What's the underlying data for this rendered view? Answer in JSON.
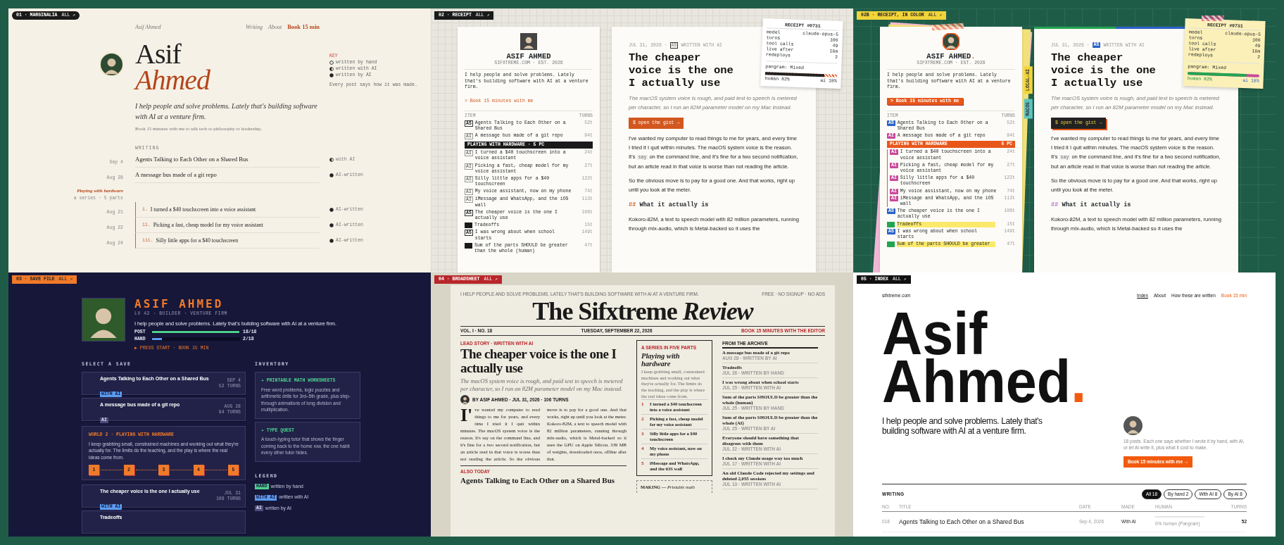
{
  "panels": [
    {
      "kind": "marginalia",
      "tag": {
        "label": "01 · MARGINALIA",
        "link": "ALL ↗"
      },
      "nav": {
        "brand": "Asif Ahmed",
        "links": [
          {
            "label": "Writing"
          },
          {
            "label": "About"
          },
          {
            "label": "Book 15 min",
            "kind": "cta"
          }
        ]
      },
      "name_first": "Asif",
      "name_last": "Ahmed",
      "key": {
        "title": "KEY",
        "items": [
          {
            "kind": "hand",
            "label": "written by hand"
          },
          {
            "kind": "with",
            "label": "written with AI"
          },
          {
            "kind": "by",
            "label": "written by AI"
          }
        ],
        "note": "Every post says how it was made."
      },
      "tagline": "I help people and solve problems. Lately that's building software with AI at a venture firm.",
      "book": {
        "link": "Book 15 minutes with me",
        "rest": " to talk tech or philosophy or leadership."
      },
      "writing_label": "WRITING",
      "posts": [
        {
          "date": "Sep 4",
          "title": "Agents Talking to Each Other on a Shared Bus",
          "made": {
            "kind": "with",
            "label": "with AI"
          }
        },
        {
          "date": "Aug 28",
          "title": "A message bus made of a git repo",
          "made": {
            "kind": "by",
            "label": "AI-written"
          }
        }
      ],
      "series": {
        "title": "Playing with hardware",
        "meta": "a series · 5 parts",
        "posts": [
          {
            "num": "i.",
            "date": "Aug 21",
            "title": "I turned a $40 touchscreen into a voice assistant",
            "made": {
              "kind": "by",
              "label": "AI-written"
            }
          },
          {
            "num": "ii.",
            "date": "Aug 22",
            "title": "Picking a fast, cheap model for my voice assistant",
            "made": {
              "kind": "by",
              "label": "AI-written"
            }
          },
          {
            "num": "iii.",
            "date": "Aug 24",
            "title": "Silly little apps for a $40 touchscreen",
            "made": {
              "kind": "by",
              "label": "AI-written"
            }
          }
        ]
      }
    },
    {
      "kind": "receipt",
      "tag": {
        "label": "02 · RECEIPT",
        "link": "ALL ↗"
      },
      "card": {
        "name": "ASIF AHMED",
        "sub": "SIFXTREME.COM · EST. 2026",
        "intro": "I help people and solve problems. Lately that's building software with AI at a venture firm.",
        "book": "> Book 15 minutes with me",
        "columns": [
          "ITEM",
          "TURNS"
        ],
        "items": [
          {
            "kind": "post",
            "badge": {
              "kind": "assisted",
              "text": "AS"
            },
            "title": "Agents Talking to Each Other on a Shared Bus",
            "turns": "52t"
          },
          {
            "kind": "post",
            "badge": {
              "kind": "ai",
              "text": "AI"
            },
            "title": "A message bus made of a git repo",
            "turns": "94t"
          },
          {
            "kind": "series",
            "title": "PLAYING WITH HARDWARE · 5 PC",
            "children": [
              {
                "kind": "post",
                "badge": {
                  "kind": "ai",
                  "text": "AI"
                },
                "title": "I turned a $40 touchscreen into a voice assistant",
                "turns": "24t"
              },
              {
                "kind": "post",
                "badge": {
                  "kind": "ai",
                  "text": "AI"
                },
                "title": "Picking a fast, cheap model for my voice assistant",
                "turns": "27t"
              },
              {
                "kind": "post",
                "badge": {
                  "kind": "ai",
                  "text": "AI"
                },
                "title": "Silly little apps for a $40 touchscreen",
                "turns": "122t"
              },
              {
                "kind": "post",
                "badge": {
                  "kind": "ai",
                  "text": "AI"
                },
                "title": "My voice assistant, now on my phone",
                "turns": "74t"
              },
              {
                "kind": "post",
                "badge": {
                  "kind": "ai",
                  "text": "AI"
                },
                "title": "iMessage and WhatsApp, and the iOS wall",
                "turns": "113t"
              }
            ]
          },
          {
            "kind": "post",
            "badge": {
              "kind": "assisted",
              "text": "AS"
            },
            "title": "The cheaper voice is the one I actually use",
            "turns": "106t"
          },
          {
            "kind": "post",
            "badge": {
              "kind": "hand"
            },
            "title": "Tradeoffs",
            "turns": "15t"
          },
          {
            "kind": "post",
            "badge": {
              "kind": "assisted",
              "text": "AS"
            },
            "title": "I was wrong about when school starts",
            "turns": "149t"
          },
          {
            "kind": "post",
            "badge": {
              "kind": "hand"
            },
            "title": "Sum of the parts SHOULD be greater than the whole (human)",
            "turns": "47t"
          }
        ]
      },
      "article": {
        "date": "JUL 31, 2026 ·",
        "badge": {
          "kind": "assisted",
          "text": "AS"
        },
        "made": "WRITTEN WITH AI",
        "title": "The cheaper voice is the one I actually use",
        "dek": "The macOS system voice is rough, and paid text to speech is metered per character, so I run an 82M parameter model on my Mac instead.",
        "button": "$ open the gist →",
        "paragraphs": [
          {
            "before": "I've wanted my computer to read things to me for years, and every time I tried it I quit within minutes. The macOS system voice is the reason. It's ",
            "code": "say",
            "after": " on the command line, and it's fine for a two second notification, but an article read in that voice is worse than not reading the article."
          },
          {
            "before": "So the obvious move is to pay for a good one. And that works, right up until you look at the meter."
          }
        ],
        "heading": {
          "mark": "##",
          "text": "What it actually is"
        },
        "last": "Kokoro-82M, a text to speech model with 82 million parameters, running through mlx-audio, which is Metal-backed so it uses the"
      },
      "receipt": {
        "title": "RECEIPT #0731",
        "rows": [
          {
            "label": "model",
            "value": "claude-opus-5"
          },
          {
            "label": "turns",
            "value": "106"
          },
          {
            "label": "tool calls",
            "value": "49"
          },
          {
            "label": "live after",
            "value": "16m"
          },
          {
            "label": "redeploys",
            "value": "2"
          }
        ],
        "pangram": "pangram: Mixed",
        "level": 0.82,
        "human": "human 82%",
        "ai": "ai 18%"
      }
    },
    {
      "kind": "receipt_color",
      "tag": {
        "label": "02B · RECEIPT, IN COLOR",
        "link": "ALL ↗"
      },
      "card": {
        "name": "ASIF AHMED",
        "period": ".",
        "sub": "SIFXTREME.COM · EST. 2026",
        "intro": "I help people and solve problems. Lately that's building software with AI at a venture firm.",
        "book": "> Book 15 minutes with me",
        "columns": [
          "ITEM",
          "TURNS"
        ],
        "items": [
          {
            "kind": "post",
            "badge": {
              "kind": "assisted",
              "text": "AS"
            },
            "title": "Agents Talking to Each Other on a Shared Bus",
            "turns": "52t"
          },
          {
            "kind": "post",
            "badge": {
              "kind": "ai",
              "text": "AI"
            },
            "title": "A message bus made of a git repo",
            "turns": "94t"
          },
          {
            "kind": "series",
            "title": "PLAYING WITH HARDWARE",
            "count": "5 PC",
            "children": [
              {
                "kind": "post",
                "badge": {
                  "kind": "ai",
                  "text": "AI"
                },
                "title": "I turned a $40 touchscreen into a voice assistant",
                "turns": "24t"
              },
              {
                "kind": "post",
                "badge": {
                  "kind": "ai",
                  "text": "AI"
                },
                "title": "Picking a fast, cheap model for my voice assistant",
                "turns": "27t"
              },
              {
                "kind": "post",
                "badge": {
                  "kind": "ai",
                  "text": "AI"
                },
                "title": "Silly little apps for a $40 touchscreen",
                "turns": "122t"
              },
              {
                "kind": "post",
                "badge": {
                  "kind": "ai",
                  "text": "AI"
                },
                "title": "My voice assistant, now on my phone",
                "turns": "74t"
              },
              {
                "kind": "post",
                "badge": {
                  "kind": "ai",
                  "text": "AI"
                },
                "title": "iMessage and WhatsApp, and the iOS wall",
                "turns": "113t"
              }
            ]
          },
          {
            "kind": "post",
            "badge": {
              "kind": "assisted",
              "text": "AS"
            },
            "title": "The cheaper voice is the one I actually use",
            "turns": "106t"
          },
          {
            "kind": "post",
            "badge": {
              "kind": "hand"
            },
            "title": "Tradeoffs",
            "turns": "15t"
          },
          {
            "kind": "post",
            "badge": {
              "kind": "assisted",
              "text": "AS"
            },
            "title": "I was wrong about when school starts",
            "turns": "149t"
          },
          {
            "kind": "post",
            "badge": {
              "kind": "hand"
            },
            "title": "Sum of the parts SHOULD be greater",
            "turns": "47t"
          }
        ]
      },
      "side_tabs": [
        {
          "label": "LOCAL-AI",
          "color": "#f2d43a"
        },
        {
          "label": "MACOS",
          "color": "#5cc3c0"
        }
      ],
      "article": {
        "date": "JUL 31, 2026 ·",
        "badge": {
          "kind": "assisted",
          "text": "AS"
        },
        "made": "WRITTEN WITH AI",
        "title": "The cheaper voice is the one I actually use",
        "dek": "The macOS system voice is rough, and paid text to speech is metered per character, so I run an 82M parameter model on my Mac instead.",
        "button": "$ open the gist →",
        "paragraphs": [
          {
            "before": "I've wanted my computer to read things to me for years, and every time I tried it I quit within minutes. The macOS system voice is the reason. It's ",
            "code": "say",
            "after": " on the command line, and it's fine for a two second notification, but an article read in that voice is worse than not reading the article."
          },
          {
            "before": "So the obvious move is to pay for a good one. And that works, right up until you look at the meter."
          }
        ],
        "heading": {
          "mark": "##",
          "text": "What it actually is"
        },
        "last": "Kokoro-82M, a text to speech model with 82 million parameters, running through mlx-audio, which is Metal-backed so it uses the"
      },
      "receipt": {
        "title": "RECEIPT #0731",
        "rows": [
          {
            "label": "model",
            "value": "claude-opus-5"
          },
          {
            "label": "turns",
            "value": "106"
          },
          {
            "label": "tool calls",
            "value": "49"
          },
          {
            "label": "live after",
            "value": "16m"
          },
          {
            "label": "redeploys",
            "value": "2"
          }
        ],
        "pangram": "pangram: Mixed",
        "level": 0.82,
        "human": "human 82%",
        "ai": "ai 18%"
      }
    },
    {
      "kind": "savefile",
      "tag": {
        "label": "03 · SAVE FILE",
        "link": "ALL ↗"
      },
      "name": "ASIF AHMED",
      "sub": "LV 42 · BUILDER · VENTURE FIRM",
      "intro": "I help people and solve problems. Lately that's building software with AI at a venture firm.",
      "stats": [
        {
          "label": "POST",
          "level": 1,
          "reading": "18/18",
          "color": "#4fd08f"
        },
        {
          "label": "HAND",
          "level": 0.11,
          "reading": "2/18",
          "color": "#5b9cf0"
        }
      ],
      "press": "▶ PRESS START · BOOK 15 MIN",
      "saves_label": "SELECT A SAVE",
      "saves": [
        {
          "kind": "save",
          "title": "Agents Talking to Each Other on a Shared Bus",
          "badge": {
            "kind": "with",
            "text": "WITH AI"
          },
          "date": "SEP 4",
          "turns": "52 TURNS"
        },
        {
          "kind": "save",
          "title": "A message bus made of a git repo",
          "badge": {
            "kind": "ai",
            "text": "AI"
          },
          "date": "AUG 28",
          "turns": "94 TURNS"
        },
        {
          "kind": "world",
          "title": "WORLD 2 · PLAYING WITH HARDWARE",
          "text": "I keep grabbing small, constrained machines and working out what they're actually for. The limits do the teaching, and the play is where the real ideas come from.",
          "levels": [
            "1",
            "2",
            "3",
            "4",
            "5"
          ]
        },
        {
          "kind": "save",
          "title": "The cheaper voice is the one I actually use",
          "badge": {
            "kind": "with",
            "text": "WITH AI"
          },
          "date": "JUL 31",
          "turns": "106 TURNS"
        },
        {
          "kind": "save",
          "title": "Tradeoffs"
        }
      ],
      "inventory_label": "INVENTORY",
      "inventory": [
        {
          "title": "✦ PRINTABLE MATH WORKSHEETS",
          "text": "Free word problems, logic puzzles and arithmetic drills for 3rd–5th grade, plus step-through animations of long division and multiplication."
        },
        {
          "title": "✦ TYPE QUEST",
          "text": "A touch-typing tutor that shows the finger coming back to the home row, the one habit every other tutor hides."
        }
      ],
      "legend_label": "LEGEND",
      "legend": [
        {
          "badge": {
            "kind": "hand",
            "text": "HAND"
          },
          "label": "written by hand"
        },
        {
          "badge": {
            "kind": "with",
            "text": "WITH AI"
          },
          "label": "written with AI"
        },
        {
          "badge": {
            "kind": "ai",
            "text": "AI"
          },
          "label": "written by AI"
        }
      ]
    },
    {
      "kind": "broadsheet",
      "tag": {
        "label": "04 · BROADSHEET",
        "link": "ALL ↗"
      },
      "topline": "I HELP PEOPLE AND SOLVE PROBLEMS. LATELY THAT'S BUILDING SOFTWARE WITH AI AT A VENTURE FIRM.",
      "topright": "FREE · NO SIGNUP · NO ADS",
      "masthead": "The Sifxtreme *Review*",
      "dateline": {
        "volume": "VOL. I · NO. 18",
        "date": "TUESDAY, SEPTEMBER 22, 2026",
        "book": "BOOK 15 MINUTES WITH THE EDITOR"
      },
      "lead": {
        "kicker": "LEAD STORY · WRITTEN WITH AI",
        "headline": "The cheaper voice is the one I actually use",
        "dek": "The macOS system voice is rough, and paid text to speech is metered per character, so I run an 82M parameter model on my Mac instead.",
        "byline": "BY ASIF AHMED · JUL 31, 2026 · 106 TURNS",
        "body": "I've wanted my computer to read things to me for years, and every time I tried it I quit within minutes. The macOS system voice is the reason. It's say on the command line, and it's fine for a two second notification, but an article read in that voice is worse than not reading the article. So the obvious move is to pay for a good one. And that works, right up until you look at the meter. Kokoro-82M, a text to speech model with 82 million parameters, running through mlx-audio, which is Metal-backed so it uses the GPU on Apple Silicon. 339 MB of weights, downloaded once, offline after that."
      },
      "also": {
        "kicker": "ALSO TODAY",
        "headline": "Agents Talking to Each Other on a Shared Bus"
      },
      "series": {
        "kicker": "A SERIES IN FIVE PARTS",
        "title": "Playing with hardware",
        "text": "I keep grabbing small, constrained machines and working out what they're actually for. The limits do the teaching, and the play is where the real ideas come from.",
        "items": [
          {
            "num": "1",
            "title": "I turned a $40 touchscreen into a voice assistant"
          },
          {
            "num": "2",
            "title": "Picking a fast, cheap model for my voice assistant"
          },
          {
            "num": "3",
            "title": "Silly little apps for a $40 touchscreen"
          },
          {
            "num": "4",
            "title": "My voice assistant, now on my phone"
          },
          {
            "num": "5",
            "title": "iMessage and WhatsApp, and the iOS wall"
          }
        ]
      },
      "making": "**MAKING —** *Printable math*",
      "archive": {
        "title": "FROM THE ARCHIVE",
        "items": [
          {
            "title": "A message bus made of a git repo",
            "meta": "AUG 28 · WRITTEN BY AI"
          },
          {
            "title": "Tradeoffs",
            "meta": "JUL 26 · WRITTEN BY HAND"
          },
          {
            "title": "I was wrong about when school starts",
            "meta": "JUL 25 · WRITTEN WITH AI"
          },
          {
            "title": "Sum of the parts SHOULD be greater than the whole (human)",
            "meta": "JUL 25 · WRITTEN BY HAND"
          },
          {
            "title": "Sum of the parts SHOULD be greater than the whole (AI)",
            "meta": "JUL 25 · WRITTEN BY AI"
          },
          {
            "title": "Everyone should have something that disagrees with them",
            "meta": "JUL 22 · WRITTEN WITH AI"
          },
          {
            "title": "I check my Claude usage way too much",
            "meta": "JUL 17 · WRITTEN WITH AI"
          },
          {
            "title": "An old Claude Code rejected my settings and deleted 2,055 sessions",
            "meta": "JUL 13 · WRITTEN WITH AI"
          }
        ]
      }
    },
    {
      "kind": "index",
      "tag": {
        "label": "05 · INDEX",
        "link": "ALL ↗"
      },
      "nav": {
        "brand": "sifxtreme.com",
        "links": [
          {
            "label": "Index",
            "selected": true
          },
          {
            "label": "About",
            "selected": false
          },
          {
            "label": "How these are written",
            "selected": false
          },
          {
            "label": "Book 15 min",
            "selected": false,
            "kind": "cta"
          }
        ]
      },
      "hero": [
        "Asif",
        "Ahmed"
      ],
      "period": ".",
      "tagline": "I help people and solve problems. Lately that's building software with AI at a venture firm.",
      "side_text": "18 posts. Each one says whether I wrote it by hand, with AI, or let AI write it, plus what it cost to make.",
      "button": "Book 15 minutes with me →",
      "writing_label": "WRITING",
      "filters": [
        {
          "label": "All 18",
          "selected": true
        },
        {
          "label": "By hand 2",
          "selected": false
        },
        {
          "label": "With AI 8",
          "selected": false
        },
        {
          "label": "By AI 8",
          "selected": false
        }
      ],
      "columns": [
        "NO.",
        "TITLE",
        "DATE",
        "MADE",
        "HUMAN",
        "TURNS"
      ],
      "rows": [
        {
          "no": "018",
          "title": "Agents Talking to Each Other on a Shared Bus",
          "date": "Sep 4, 2026",
          "made": "With AI",
          "human": "0% human (Pangram)",
          "level": 0,
          "turns": "52"
        }
      ]
    }
  ]
}
